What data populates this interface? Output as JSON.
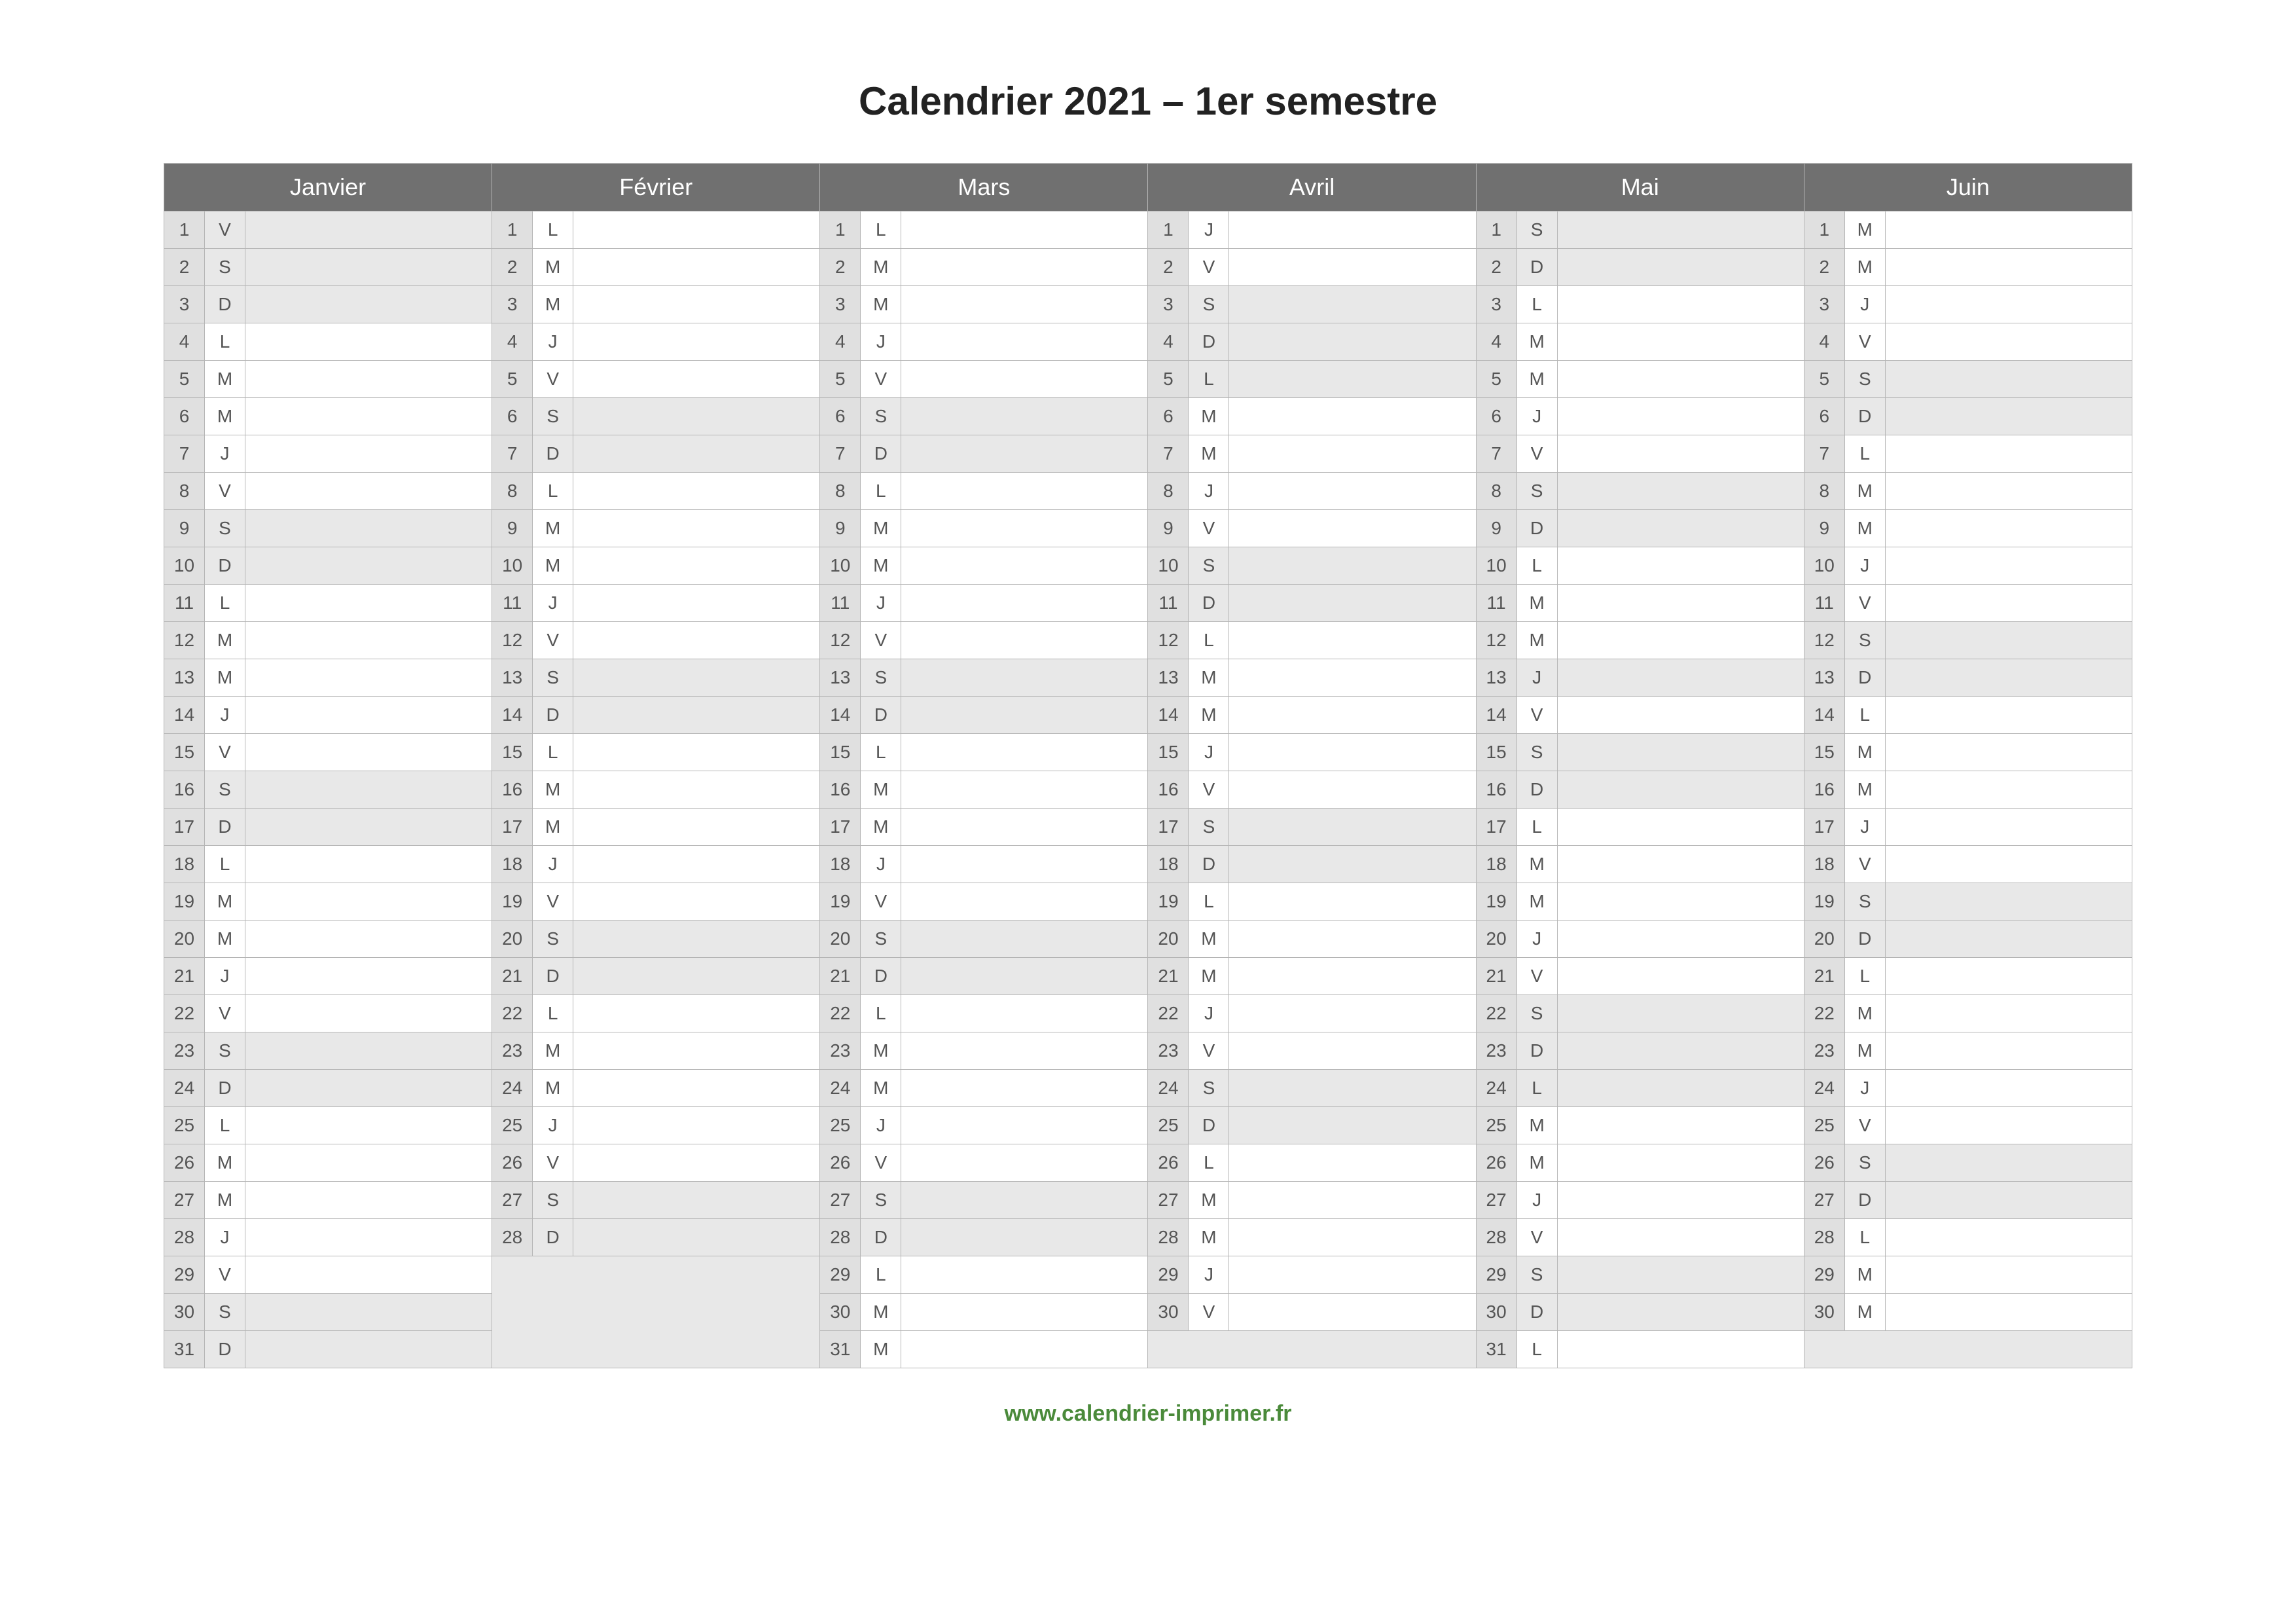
{
  "title": "Calendrier 2021 – 1er semestre",
  "footer": "www.calendrier-imprimer.fr",
  "months": [
    {
      "name": "Janvier",
      "days": 31,
      "start": 4
    },
    {
      "name": "Février",
      "days": 28,
      "start": 0
    },
    {
      "name": "Mars",
      "days": 31,
      "start": 0
    },
    {
      "name": "Avril",
      "days": 30,
      "start": 3
    },
    {
      "name": "Mai",
      "days": 31,
      "start": 5
    },
    {
      "name": "Juin",
      "days": 30,
      "start": 1
    }
  ],
  "weekday_letters": [
    "L",
    "M",
    "M",
    "J",
    "V",
    "S",
    "D"
  ],
  "holidays": {
    "0": [
      1
    ],
    "3": [
      5
    ],
    "4": [
      1,
      8,
      13,
      24
    ]
  },
  "chart_data": {
    "type": "table",
    "title": "Calendrier 2021 – 1er semestre",
    "months": [
      {
        "name": "Janvier",
        "days": 31,
        "first_weekday": "V"
      },
      {
        "name": "Février",
        "days": 28,
        "first_weekday": "L"
      },
      {
        "name": "Mars",
        "days": 31,
        "first_weekday": "L"
      },
      {
        "name": "Avril",
        "days": 30,
        "first_weekday": "J"
      },
      {
        "name": "Mai",
        "days": 31,
        "first_weekday": "S"
      },
      {
        "name": "Juin",
        "days": 30,
        "first_weekday": "M"
      }
    ]
  }
}
